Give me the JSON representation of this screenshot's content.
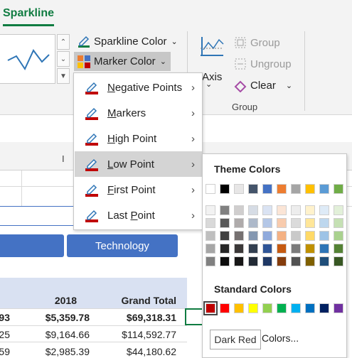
{
  "ribbon": {
    "tab": "Sparkline",
    "sparkline_color": "Sparkline Color",
    "marker_color": "Marker Color",
    "axis": "Axis",
    "group": "Group",
    "ungroup": "Ungroup",
    "clear": "Clear",
    "group_section_label": "Group"
  },
  "sheet": {
    "column_letter": "I",
    "slicer_button": "Technology",
    "pivot": {
      "header": [
        "2018",
        "Grand Total"
      ],
      "rows": [
        {
          "left": "93",
          "y2018": "$5,359.78",
          "total": "$69,318.31"
        },
        {
          "left": "25",
          "y2018": "$9,164.66",
          "total": "$114,592.77"
        },
        {
          "left": "59",
          "y2018": "$2,985.39",
          "total": "$44,180.62"
        }
      ]
    }
  },
  "marker_menu": {
    "items": [
      {
        "label": "Negative Points",
        "underline": "N"
      },
      {
        "label": "Markers",
        "underline": "M"
      },
      {
        "label": "High Point",
        "underline": "H"
      },
      {
        "label": "Low Point",
        "underline": "L"
      },
      {
        "label": "First Point",
        "underline": "F"
      },
      {
        "label": "Last Point",
        "underline": "P"
      }
    ],
    "active_index": 3
  },
  "color_picker": {
    "theme_title": "Theme Colors",
    "standard_title": "Standard Colors",
    "theme_top": [
      "#ffffff",
      "#000000",
      "#e7e6e6",
      "#44546a",
      "#4472c4",
      "#ed7d31",
      "#a5a5a5",
      "#ffc000",
      "#5b9bd5",
      "#70ad47"
    ],
    "theme_shades": [
      [
        "#f2f2f2",
        "#d9d9d9",
        "#bfbfbf",
        "#a6a6a6",
        "#808080"
      ],
      [
        "#808080",
        "#595959",
        "#404040",
        "#262626",
        "#0d0d0d"
      ],
      [
        "#d0cece",
        "#afabab",
        "#767171",
        "#3b3838",
        "#181717"
      ],
      [
        "#d6dce5",
        "#adb9ca",
        "#8497b0",
        "#333f50",
        "#222a35"
      ],
      [
        "#dae3f3",
        "#b4c7e7",
        "#8faadc",
        "#2f5597",
        "#1f3864"
      ],
      [
        "#fbe5d6",
        "#f8cbad",
        "#f4b183",
        "#c55a11",
        "#843c0c"
      ],
      [
        "#ededed",
        "#dbdbdb",
        "#c9c9c9",
        "#7b7b7b",
        "#525252"
      ],
      [
        "#fff2cc",
        "#ffe699",
        "#ffd966",
        "#bf9000",
        "#7f6000"
      ],
      [
        "#deebf7",
        "#bdd7ee",
        "#9dc3e6",
        "#2e75b6",
        "#1f4e79"
      ],
      [
        "#e2f0d9",
        "#c5e0b4",
        "#a9d18e",
        "#548235",
        "#385723"
      ]
    ],
    "standard": [
      "#c00000",
      "#ff0000",
      "#ffc000",
      "#ffff00",
      "#92d050",
      "#00b050",
      "#00b0f0",
      "#0070c0",
      "#002060",
      "#7030a0"
    ],
    "selected_standard_index": 0,
    "tooltip": "Dark Red",
    "more_colors": "Colors..."
  }
}
